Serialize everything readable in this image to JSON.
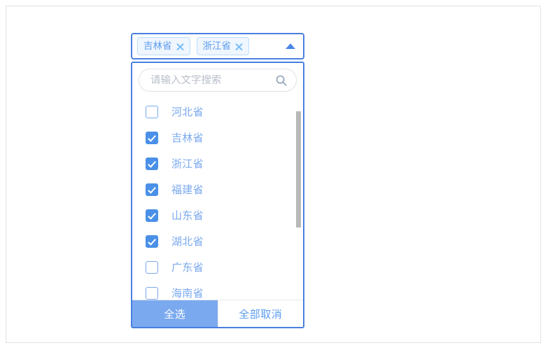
{
  "widget": {
    "name": "province-multiselect",
    "selected_tags": [
      {
        "label": "吉林省",
        "close_icon": "close-icon"
      },
      {
        "label": "浙江省",
        "close_icon": "close-icon"
      }
    ],
    "caret_icon": "caret-up-icon",
    "search": {
      "placeholder": "请输入文字搜索",
      "value": "",
      "icon": "search-icon"
    },
    "options": [
      {
        "label": "河北省",
        "checked": false
      },
      {
        "label": "吉林省",
        "checked": true
      },
      {
        "label": "浙江省",
        "checked": true
      },
      {
        "label": "福建省",
        "checked": true
      },
      {
        "label": "山东省",
        "checked": true
      },
      {
        "label": "湖北省",
        "checked": true
      },
      {
        "label": "广东省",
        "checked": false
      },
      {
        "label": "海南省",
        "checked": false
      }
    ],
    "footer": {
      "select_all_label": "全选",
      "clear_all_label": "全部取消"
    },
    "colors": {
      "accent_border": "#4a7fe0",
      "tag_text": "#5b9cf0",
      "tag_bg": "#eff6fe",
      "tag_border": "#bcddfb",
      "checkbox_checked": "#4a90e8",
      "option_text": "#7aa9ef",
      "primary_button_bg": "#7aa9ef",
      "placeholder_text": "#b9bec9",
      "scrollbar_thumb": "#b9b9b9",
      "page_border": "#e2e2e2"
    }
  }
}
